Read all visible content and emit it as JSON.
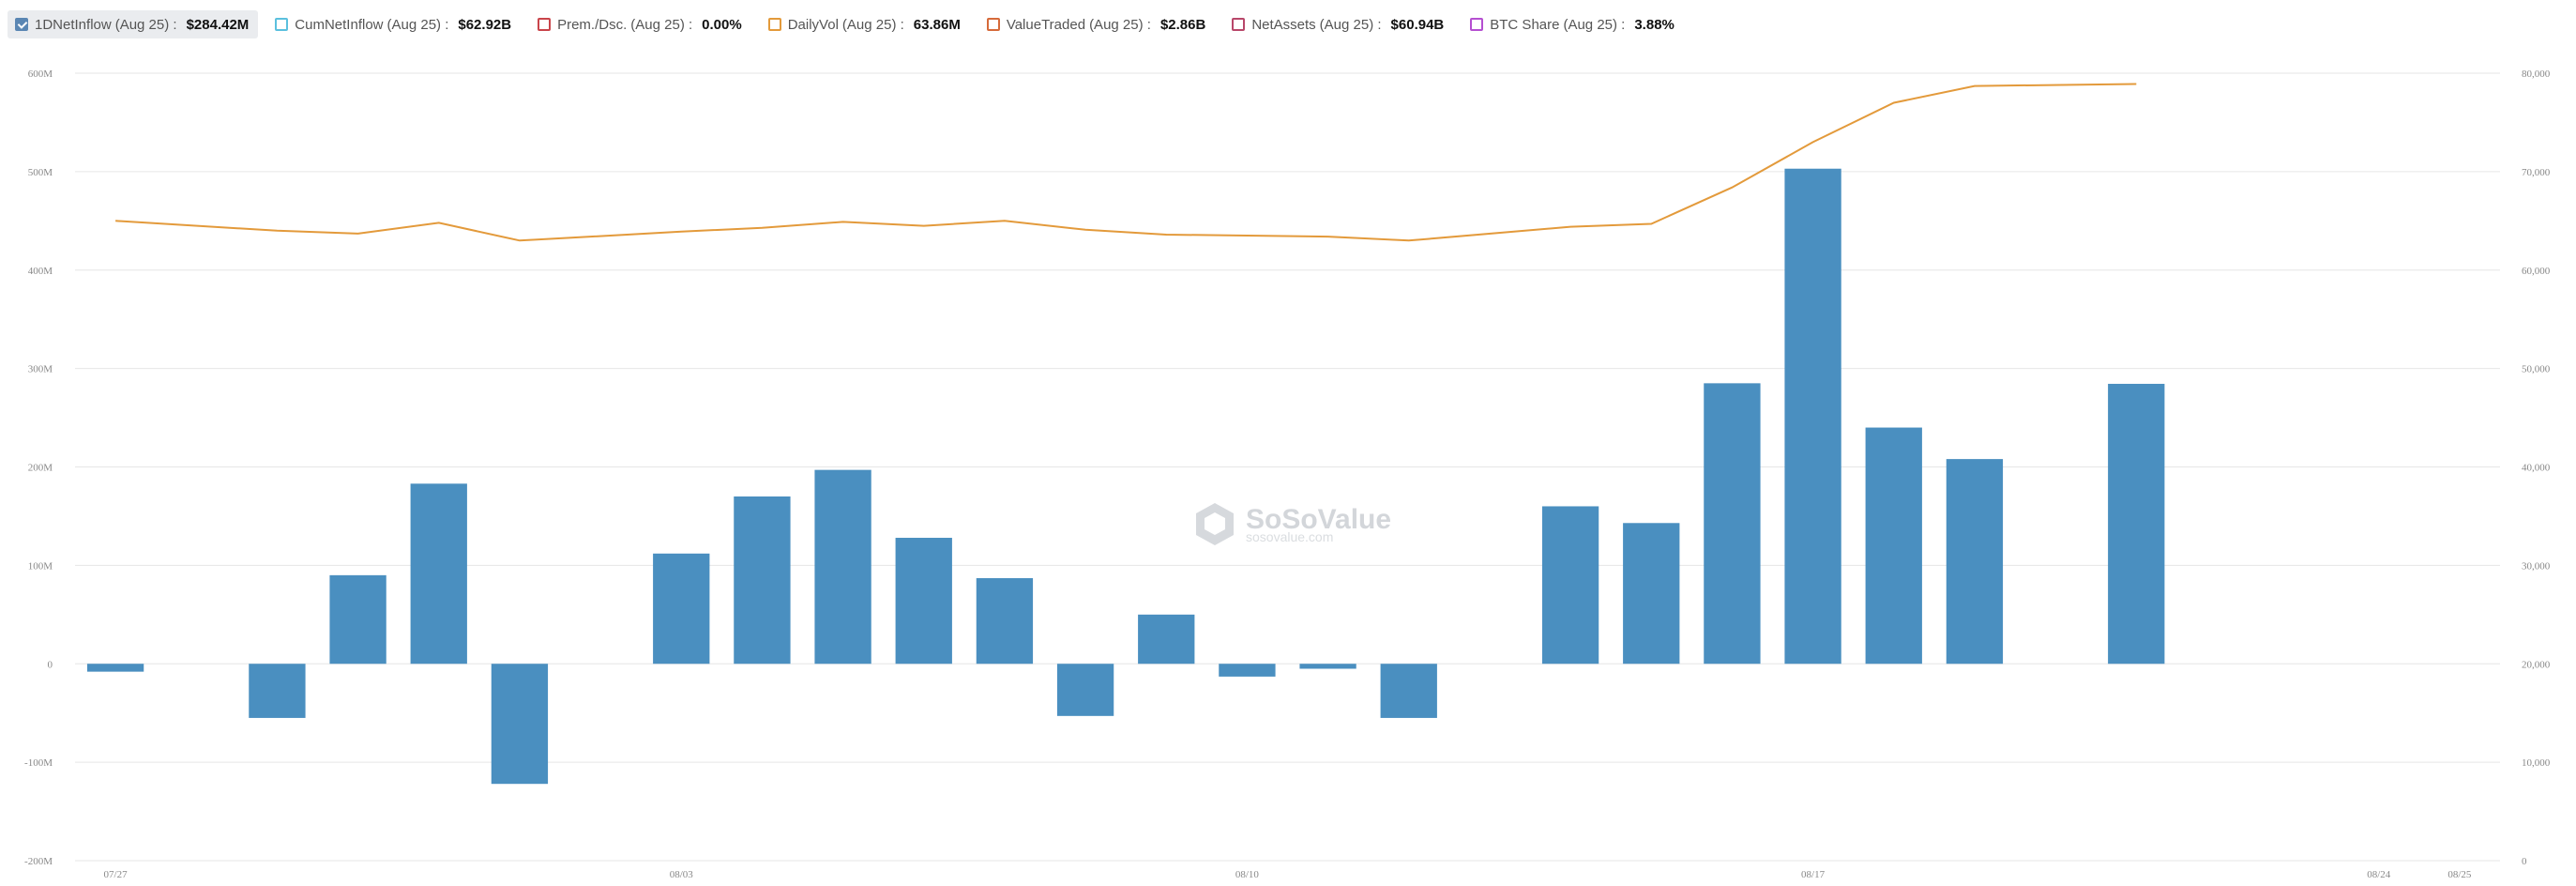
{
  "legend": [
    {
      "label": "1DNetInflow",
      "period": "(Aug 25) :",
      "value": "$284.42M",
      "checked": true,
      "color": "#4a8fc0"
    },
    {
      "label": "CumNetInflow",
      "period": "(Aug 25) :",
      "value": "$62.92B",
      "checked": false,
      "color": "#5bc0de"
    },
    {
      "label": "Prem./Dsc.",
      "period": "(Aug 25) :",
      "value": "0.00%",
      "checked": false,
      "color": "#c9444a"
    },
    {
      "label": "DailyVol",
      "period": "(Aug 25) :",
      "value": "63.86M",
      "checked": false,
      "color": "#e39a3b"
    },
    {
      "label": "ValueTraded",
      "period": "(Aug 25) :",
      "value": "$2.86B",
      "checked": false,
      "color": "#d66a3a"
    },
    {
      "label": "NetAssets",
      "period": "(Aug 25) :",
      "value": "$60.94B",
      "checked": false,
      "color": "#b8476a"
    },
    {
      "label": "BTC Share",
      "period": "(Aug 25) :",
      "value": "3.88%",
      "checked": false,
      "color": "#b54fd1"
    }
  ],
  "watermark": {
    "brand": "SoSoValue",
    "site": "sosovalue.com"
  },
  "chart_data": {
    "type": "bar",
    "grid": true,
    "categories": [
      "07/27",
      "07/28",
      "07/29",
      "07/30",
      "07/31",
      "08/01",
      "08/02",
      "08/03",
      "08/04",
      "08/05",
      "08/06",
      "08/07",
      "08/08",
      "08/09",
      "08/10",
      "08/11",
      "08/12",
      "08/13",
      "08/14",
      "08/15",
      "08/16",
      "08/17",
      "08/18",
      "08/19",
      "08/20",
      "08/21",
      "08/22",
      "08/23",
      "08/24",
      "08/25"
    ],
    "x_tick_labels": [
      "07/27",
      "08/03",
      "08/10",
      "08/17",
      "08/24",
      "08/25"
    ],
    "bar_series": {
      "name": "1DNetInflow",
      "color": "#4a8fc0",
      "dates": [
        "07/27",
        "07/29",
        "07/30",
        "07/31",
        "08/01",
        "08/03",
        "08/04",
        "08/05",
        "08/06",
        "08/07",
        "08/08",
        "08/09",
        "08/10",
        "08/11",
        "08/12",
        "08/14",
        "08/15",
        "08/16",
        "08/17",
        "08/18",
        "08/19",
        "08/21",
        "08/22"
      ],
      "values": [
        -8,
        -55,
        90,
        183,
        -122,
        112,
        170,
        197,
        128,
        87,
        -53,
        50,
        -13,
        -5,
        -55,
        160,
        143,
        285,
        503,
        240,
        208,
        284.42
      ]
    },
    "line_series": {
      "name": "DailyVol",
      "color": "#e39a3b",
      "dates": [
        "07/27",
        "07/29",
        "07/30",
        "07/31",
        "08/01",
        "08/03",
        "08/04",
        "08/05",
        "08/06",
        "08/07",
        "08/08",
        "08/09",
        "08/10",
        "08/11",
        "08/12",
        "08/14",
        "08/15",
        "08/16",
        "08/17",
        "08/18",
        "08/19",
        "08/21",
        "08/22",
        "08/24",
        "08/25"
      ],
      "values": [
        65000,
        64000,
        63700,
        64800,
        63000,
        63900,
        64300,
        64900,
        64500,
        65000,
        64100,
        63600,
        63500,
        63400,
        63000,
        64400,
        64700,
        68400,
        73000,
        77000,
        78700,
        78900
      ]
    },
    "y_left": {
      "min": -200,
      "max": 600,
      "ticks": [
        "-200M",
        "-100M",
        "0",
        "100M",
        "200M",
        "300M",
        "400M",
        "500M",
        "600M"
      ]
    },
    "y_right": {
      "min": 0,
      "max": 80000,
      "ticks": [
        "0",
        "10,000",
        "20,000",
        "30,000",
        "40,000",
        "50,000",
        "60,000",
        "70,000",
        "80,000"
      ]
    }
  }
}
